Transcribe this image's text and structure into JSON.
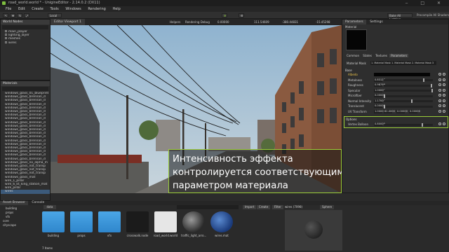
{
  "window": {
    "title": "road_world.world * - UnigineEditor - 2.14.0.2 (DX11)"
  },
  "menu": [
    "File",
    "Edit",
    "Create",
    "Tools",
    "Windows",
    "Rendering",
    "Help"
  ],
  "toolbar": {
    "mode": "Local",
    "bake_button": "Bake All Lighting",
    "precompile": "Precompile All Shaders"
  },
  "world_nodes": {
    "header": "World Nodes",
    "items": [
      "main_player",
      "lighting_layer",
      "meshes",
      "wires"
    ]
  },
  "materials": {
    "header": "Materials",
    "items": [
      "windows_glass_01_blueprint",
      "windows_glass_brennan_d",
      "windows_glass_brennan_d",
      "windows_glass_brennan_d",
      "windows_glass_brennan_d",
      "windows_glass_brennan_d",
      "windows_glass_brennan_d",
      "windows_glass_brennan_d",
      "windows_glass_brennan_d",
      "windows_glass_brennan_d",
      "windows_glass_brennan_d",
      "windows_glass_brennan_d",
      "windows_glass_brennan_d",
      "windows_glass_brennan_d",
      "windows_glass_brennan_d",
      "windows_glass_brennan_d",
      "windows_glass_brennan_d",
      "windows_glass_brennan_d",
      "windows_glass_brennan_d",
      "windows_glass_no_alpha_m",
      "windows_glass_not_transp",
      "windows_glass_not_transp",
      "windows_glass_not_transp",
      "windows_glass_mat",
      "wire_1_pillar",
      "wire_6_kt_king_station_mat",
      "wire_pillar",
      "wires"
    ]
  },
  "viewport": {
    "tab": "Editor Viewport 1",
    "menu_items": [
      "Helpers",
      "Rendering Debug",
      "0.00000",
      "111.54609",
      "-380.44831",
      "-15.45298"
    ],
    "caption": [
      "Интенсивность эффекта",
      "контролируется соответствующим",
      "параметром материала"
    ]
  },
  "parameters": {
    "tabs": [
      "Parameters",
      "Settings"
    ],
    "material_label": "Material",
    "sub_tabs": [
      "Common",
      "States",
      "Textures",
      "Parameters"
    ],
    "material_field_label": "Material Mask",
    "material_field_value": "1. Material Mask 1. Material Mask 2. Material Mask 3",
    "section_base": "Base",
    "rows": [
      {
        "label": "Albedo",
        "value": "",
        "knob": 0
      },
      {
        "label": "Metalness",
        "value": "0.83127",
        "knob": 0.83
      },
      {
        "label": "Roughness",
        "value": "0.98799",
        "knob": 0.98
      },
      {
        "label": "Specular",
        "value": "1.00000",
        "knob": 1.0
      },
      {
        "label": "Microfiber",
        "value": "0.00000",
        "knob": 0.0
      },
      {
        "label": "Normal Intensity",
        "value": "1.17000",
        "knob": 0.58
      },
      {
        "label": "Translucent",
        "value": "0.00000",
        "knob": 0.0
      },
      {
        "label": "UV Transform",
        "value": "1.00000",
        "knob": 0
      }
    ],
    "uv_extra": [
      "82.0000",
      "0.00000",
      "0.00000"
    ],
    "section_options": "Options",
    "vertex_row": {
      "label": "Vertex Balloon",
      "value": "0.80000",
      "knob": 0.8
    }
  },
  "asset_browser": {
    "header": "Asset Browser",
    "console_tab": "Console",
    "path_label": "data",
    "import_button": "Import",
    "create_button": "Create",
    "filter_button": "Filter",
    "folders": [
      "building",
      "props",
      "vfx",
      "core",
      "cityscape"
    ],
    "assets": [
      {
        "name": "building",
        "kind": "folder"
      },
      {
        "name": "props",
        "kind": "folder"
      },
      {
        "name": "vfx",
        "kind": "folder"
      },
      {
        "name": "crosswalk.node",
        "kind": "file"
      },
      {
        "name": "road_world.world",
        "kind": "world"
      },
      {
        "name": "traffic_light_arro...",
        "kind": "sphere"
      },
      {
        "name": "wires.mat",
        "kind": "sphere-blue"
      }
    ],
    "status": "7 Items",
    "preview_title": "wires (7098)",
    "preview_tab": "Sphere"
  }
}
